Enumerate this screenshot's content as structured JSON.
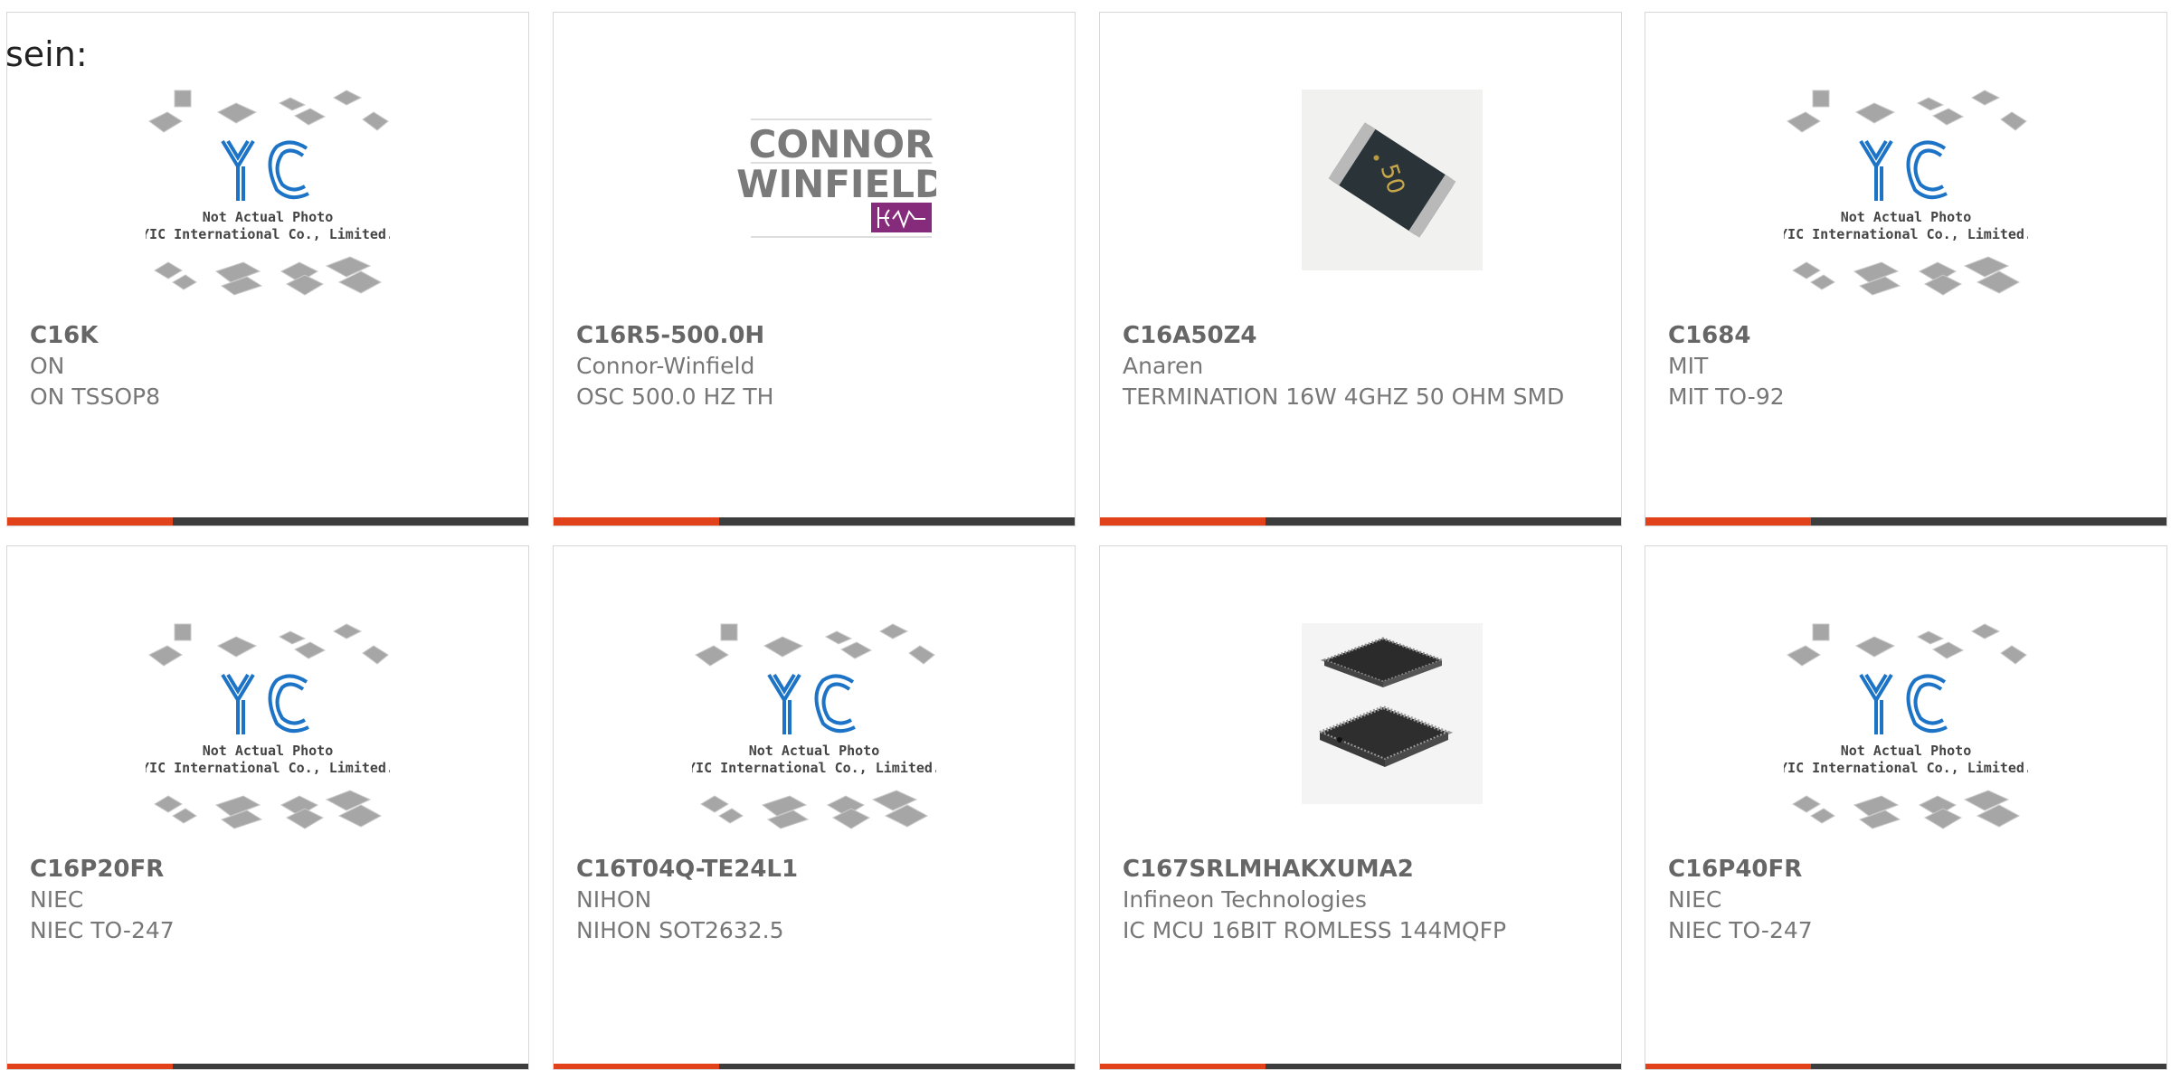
{
  "fragment": "sein:",
  "placeholder": {
    "line1": "Not Actual Photo",
    "line2": "YIC International Co., Limited.",
    "logo": "YIC"
  },
  "connor_logo": {
    "line1": "CONNOR",
    "line2": "WINFIELD"
  },
  "chip_label": "50",
  "colors": {
    "accent": "#e2421a",
    "bar": "#3d3d3d",
    "logo_blue": "#1d74c6"
  },
  "products": [
    {
      "part": "C16K",
      "manufacturer": "ON",
      "description": "ON TSSOP8",
      "image": "yic-placeholder"
    },
    {
      "part": "C16R5-500.0H",
      "manufacturer": "Connor-Winfield",
      "description": "OSC 500.0 HZ TH",
      "image": "connor-winfield-logo"
    },
    {
      "part": "C16A50Z4",
      "manufacturer": "Anaren",
      "description": "TERMINATION 16W 4GHZ 50 OHM SMD",
      "image": "resistor-chip-photo"
    },
    {
      "part": "C1684",
      "manufacturer": "MIT",
      "description": "MIT TO-92",
      "image": "yic-placeholder"
    },
    {
      "part": "C16P20FR",
      "manufacturer": "NIEC",
      "description": "NIEC TO-247",
      "image": "yic-placeholder"
    },
    {
      "part": "C16T04Q-TE24L1",
      "manufacturer": "NIHON",
      "description": "NIHON SOT2632.5",
      "image": "yic-placeholder"
    },
    {
      "part": "C167SRLMHAKXUMA2",
      "manufacturer": "Infineon Technologies",
      "description": "IC MCU 16BIT ROMLESS 144MQFP",
      "image": "qfp-chip-photo"
    },
    {
      "part": "C16P40FR",
      "manufacturer": "NIEC",
      "description": "NIEC TO-247",
      "image": "yic-placeholder"
    }
  ]
}
